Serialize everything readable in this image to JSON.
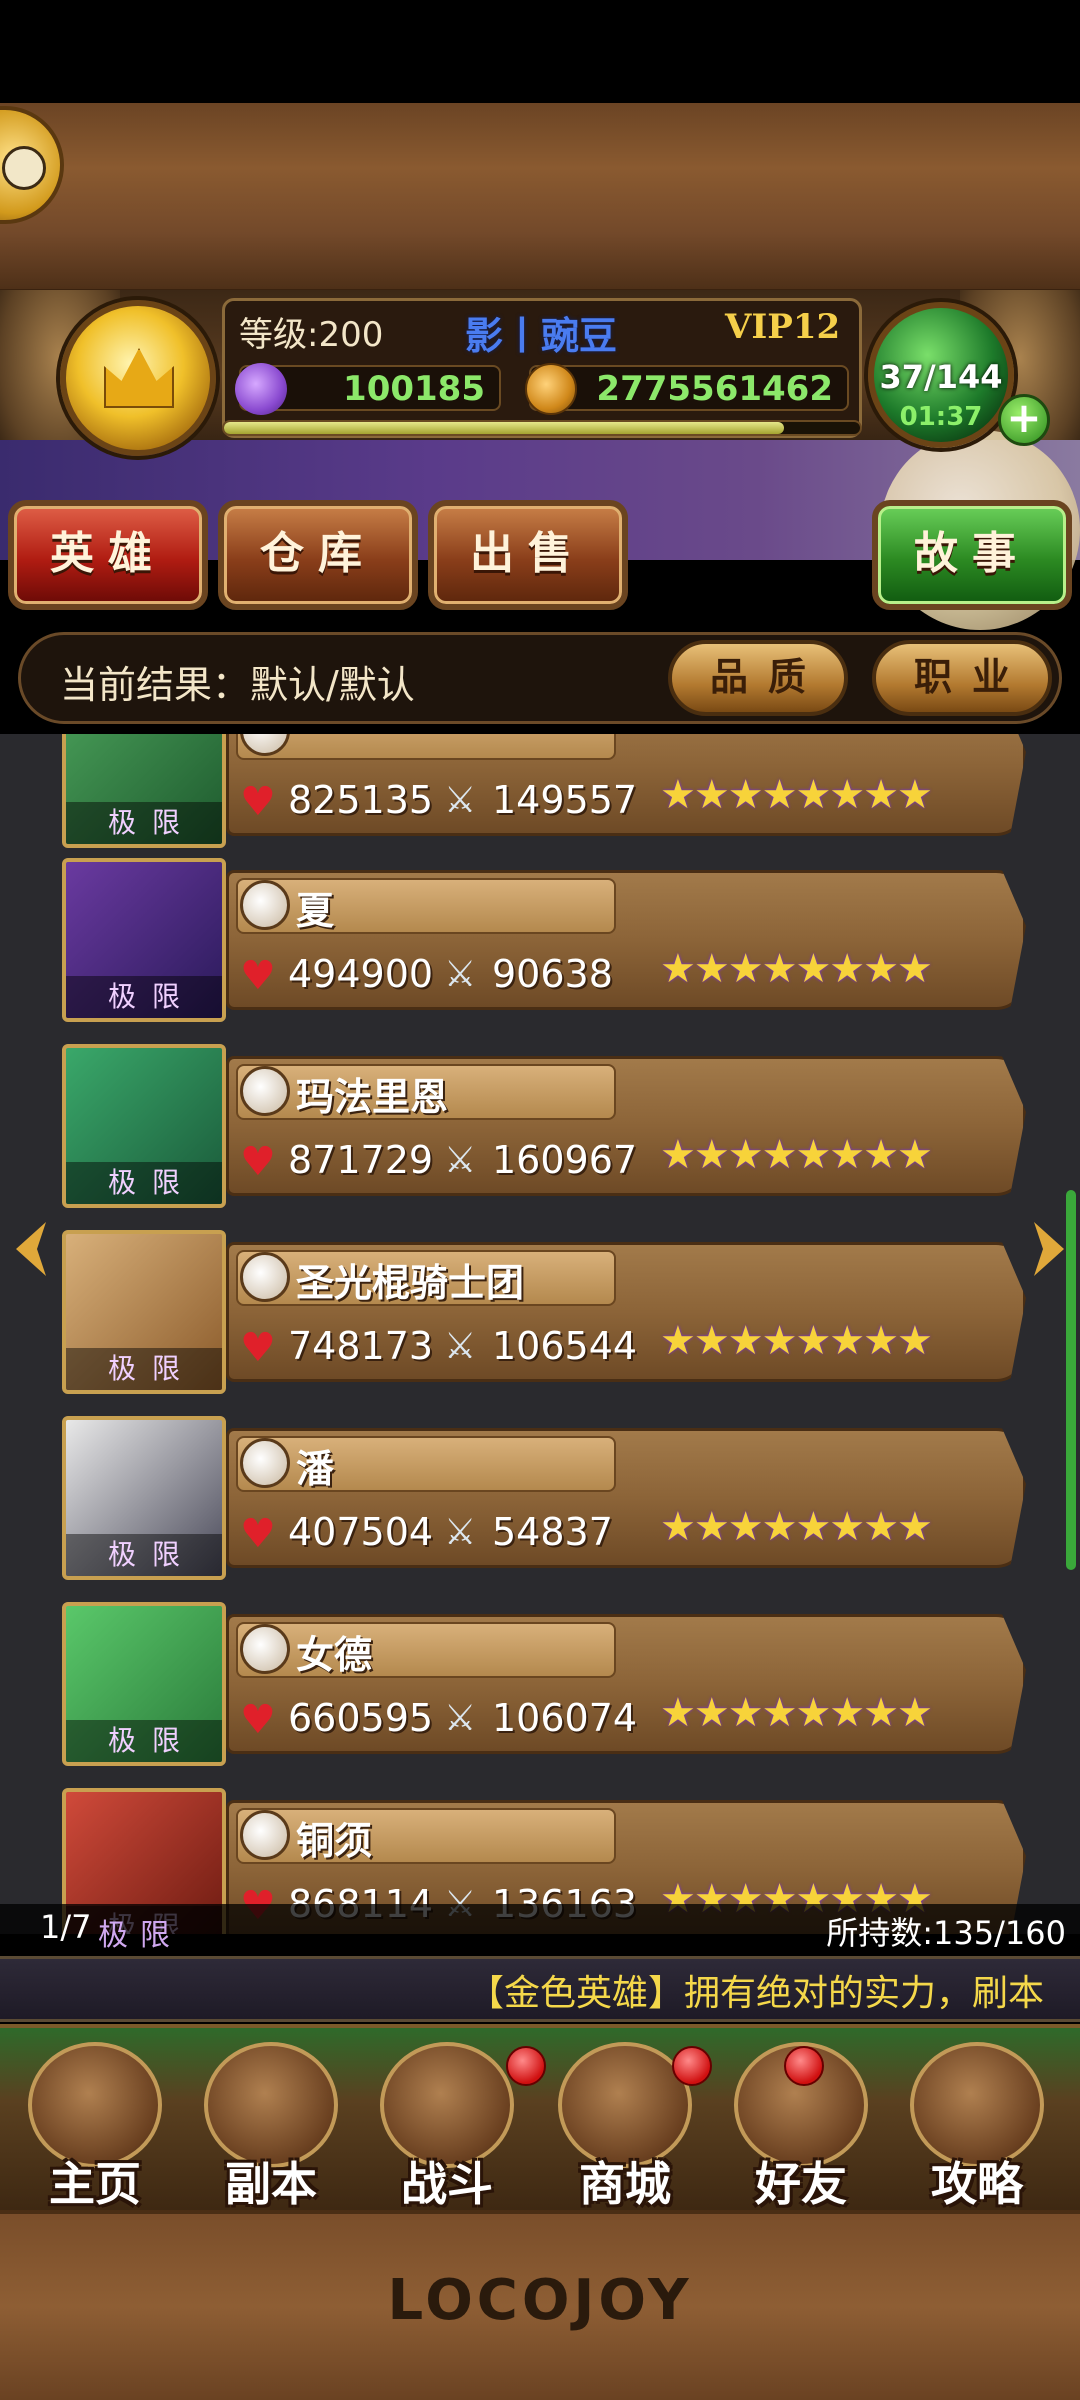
{
  "player": {
    "level_text": "等级:200",
    "name": "影丨豌豆",
    "vip": "VIP12",
    "gems": "100185",
    "gold": "2775561462",
    "stamina": "37/144",
    "stamina_timer": "01:37",
    "exp_fraction": 0.88
  },
  "tabs": {
    "heroes": "英雄",
    "warehouse": "仓库",
    "sell": "出售",
    "story": "故事"
  },
  "filter": {
    "label": "当前结果：默认/默认",
    "quality": "品质",
    "class": "职业"
  },
  "heroes": [
    {
      "name": "",
      "tag": "极限",
      "hp": "825135",
      "atk": "149557",
      "stars": "★★★★★★★★",
      "class_icon": "leaf-icon"
    },
    {
      "name": "夏",
      "tag": "极限",
      "hp": "494900",
      "atk": "90638",
      "stars": "★★★★★★★★",
      "class_icon": "shield-icon"
    },
    {
      "name": "玛法里恩",
      "tag": "极限",
      "hp": "871729",
      "atk": "160967",
      "stars": "★★★★★★★★",
      "class_icon": "paw-icon"
    },
    {
      "name": "圣光棍骑士团",
      "tag": "极限",
      "hp": "748173",
      "atk": "106544",
      "stars": "★★★★★★★★",
      "class_icon": "staff-icon"
    },
    {
      "name": "潘",
      "tag": "极限",
      "hp": "407504",
      "atk": "54837",
      "stars": "★★★★★★★★",
      "class_icon": "potion-icon"
    },
    {
      "name": "女德",
      "tag": "极限",
      "hp": "660595",
      "atk": "106074",
      "stars": "★★★★★★★★",
      "class_icon": "paw-icon"
    },
    {
      "name": "铜须",
      "tag": "极限",
      "hp": "868114",
      "atk": "136163",
      "stars": "★★★★★★★★",
      "class_icon": "shield-icon"
    }
  ],
  "list_footer": {
    "page": "1/7",
    "page_tag": "极限",
    "owned": "所持数:135/160"
  },
  "ticker": "【金色英雄】拥有绝对的实力，刷本",
  "nav": {
    "home": "主页",
    "dungeon": "副本",
    "battle": "战斗",
    "shop": "商城",
    "friends": "好友",
    "guide": "攻略"
  },
  "footer": {
    "logo": "LOCOJOY"
  },
  "colors": {
    "gem_green": "#8ce86a",
    "name_blue": "#4a7cf0",
    "vip_gold": "#f5cf4a"
  }
}
